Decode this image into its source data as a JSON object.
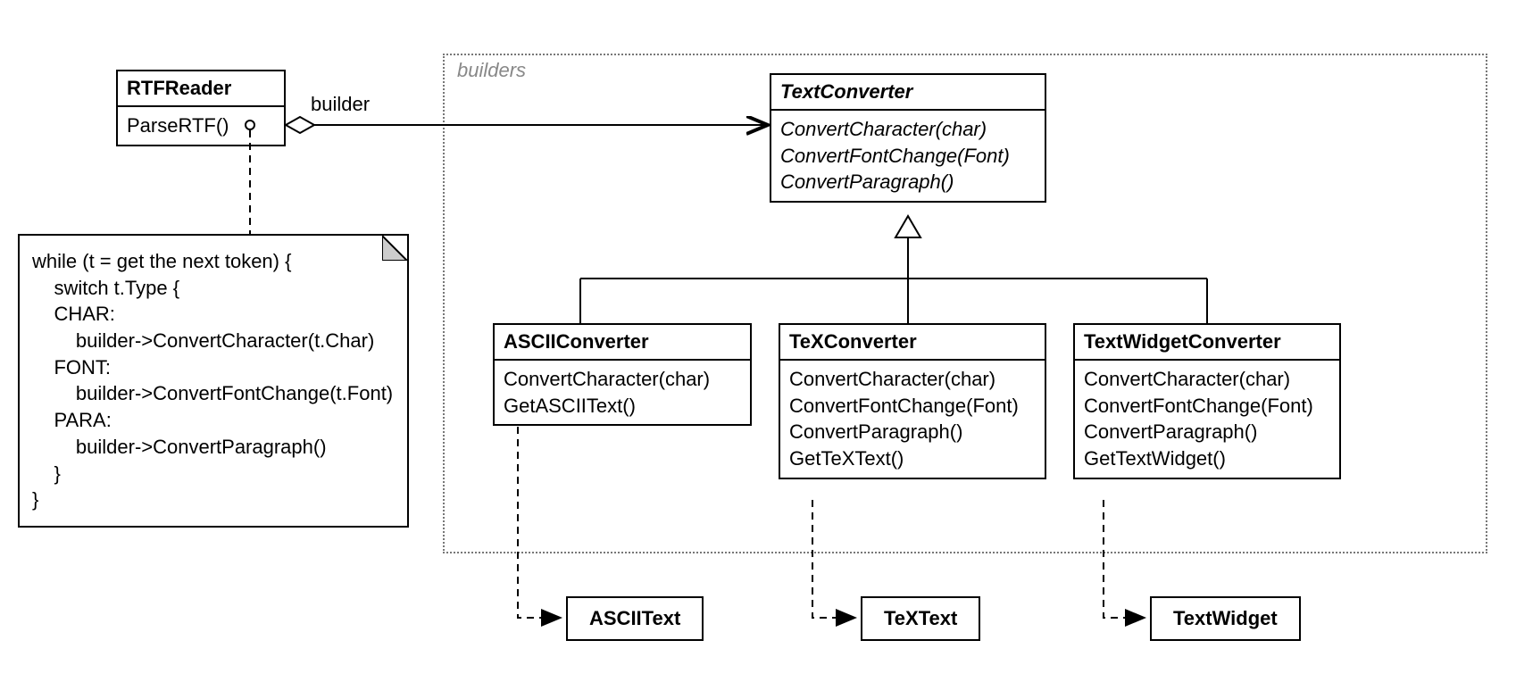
{
  "rtfreader": {
    "title": "RTFReader",
    "method": "ParseRTF()"
  },
  "assoc_label": "builder",
  "builders_frame_label": "builders",
  "textconverter": {
    "title": "TextConverter",
    "m1": "ConvertCharacter(char)",
    "m2": "ConvertFontChange(Font)",
    "m3": "ConvertParagraph()"
  },
  "ascii": {
    "title": "ASCIIConverter",
    "m1": "ConvertCharacter(char)",
    "m2": "GetASCIIText()"
  },
  "tex": {
    "title": "TeXConverter",
    "m1": "ConvertCharacter(char)",
    "m2": "ConvertFontChange(Font)",
    "m3": "ConvertParagraph()",
    "m4": "GetTeXText()"
  },
  "widget": {
    "title": "TextWidgetConverter",
    "m1": "ConvertCharacter(char)",
    "m2": "ConvertFontChange(Font)",
    "m3": "ConvertParagraph()",
    "m4": "GetTextWidget()"
  },
  "products": {
    "ascii": "ASCIIText",
    "tex": "TeXText",
    "widget": "TextWidget"
  },
  "note": {
    "l1": "while (t = get the next token) {",
    "l2": "    switch t.Type {",
    "l3": "    CHAR:",
    "l4": "        builder->ConvertCharacter(t.Char)",
    "l5": "    FONT:",
    "l6": "        builder->ConvertFontChange(t.Font)",
    "l7": "    PARA:",
    "l8": "        builder->ConvertParagraph()",
    "l9": "    }",
    "l10": "}"
  }
}
